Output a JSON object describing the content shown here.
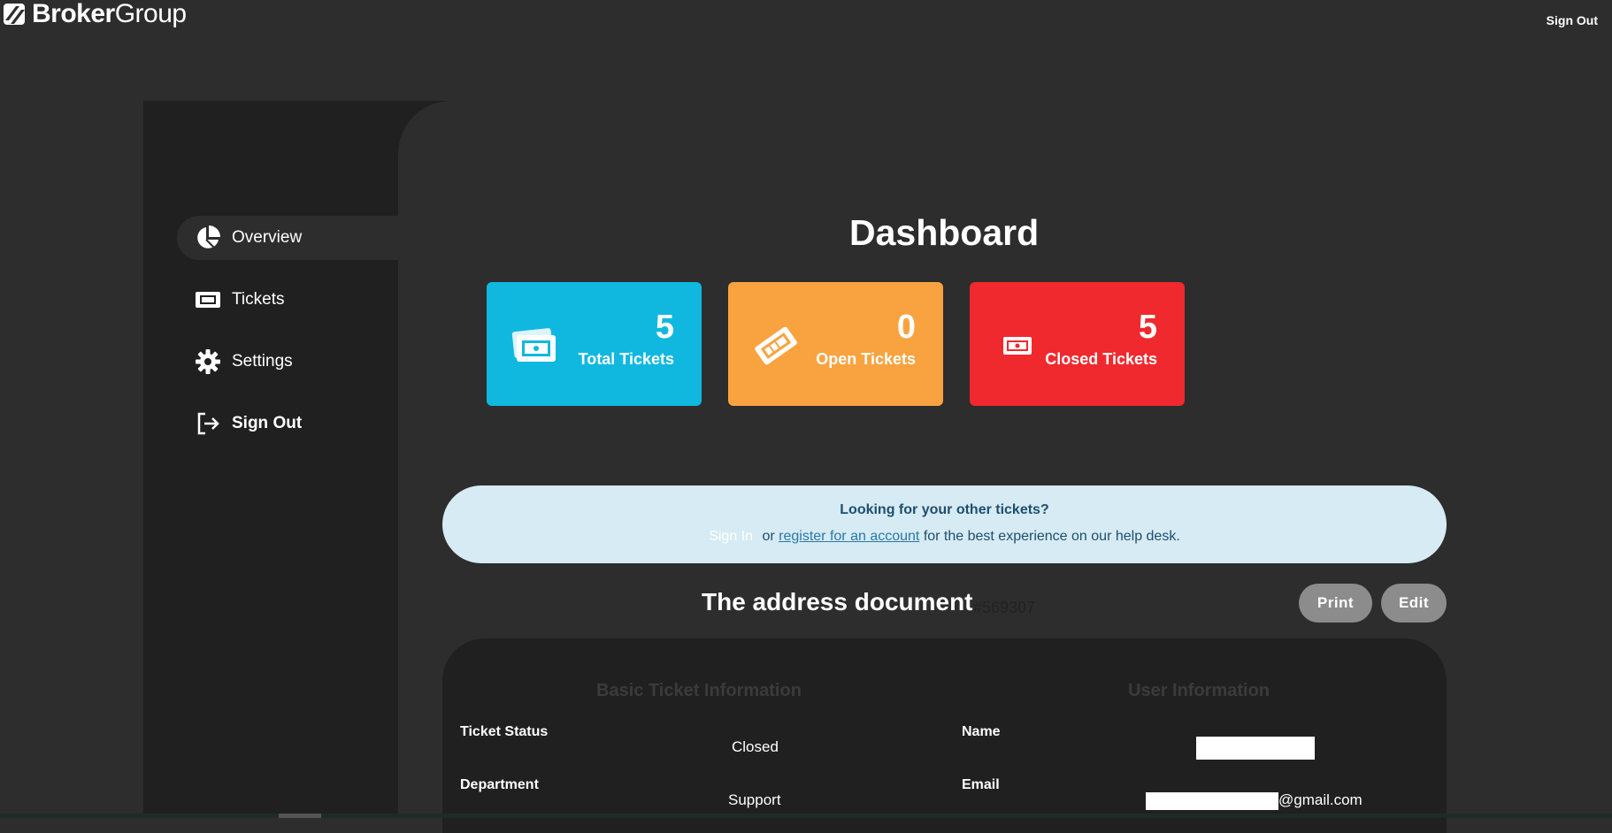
{
  "brand": {
    "name_bold": "Broker",
    "name_regular": "Group"
  },
  "topbar": {
    "signout_label": "Sign Out"
  },
  "sidebar": {
    "items": [
      {
        "label": "Overview",
        "icon": "pie-chart-icon"
      },
      {
        "label": "Tickets",
        "icon": "ticket-icon"
      },
      {
        "label": "Settings",
        "icon": "gear-icon"
      },
      {
        "label": "Sign Out",
        "icon": "sign-out-icon"
      }
    ]
  },
  "dashboard": {
    "title": "Dashboard",
    "cards": [
      {
        "count": "5",
        "label": "Total Tickets",
        "color": "#10b8e0",
        "icon": "tickets-icon"
      },
      {
        "count": "0",
        "label": "Open Tickets",
        "color": "#f9a340",
        "icon": "ticket-open-icon"
      },
      {
        "count": "5",
        "label": "Closed Tickets",
        "color": "#f0292e",
        "icon": "ticket-closed-icon"
      }
    ]
  },
  "notice": {
    "title": "Looking for your other tickets?",
    "signin": "Sign In",
    "or": "or",
    "register": "register for an account",
    "rest": "for the best experience on our help desk."
  },
  "ticket": {
    "title": "The address document",
    "id": "#569307",
    "print_label": "Print",
    "edit_label": "Edit",
    "basic_heading": "Basic Ticket Information",
    "user_heading": "User Information",
    "status_label": "Ticket Status",
    "status_value": "Closed",
    "department_label": "Department",
    "department_value": "Support",
    "name_label": "Name",
    "email_label": "Email",
    "email_suffix": "@gmail.com"
  }
}
